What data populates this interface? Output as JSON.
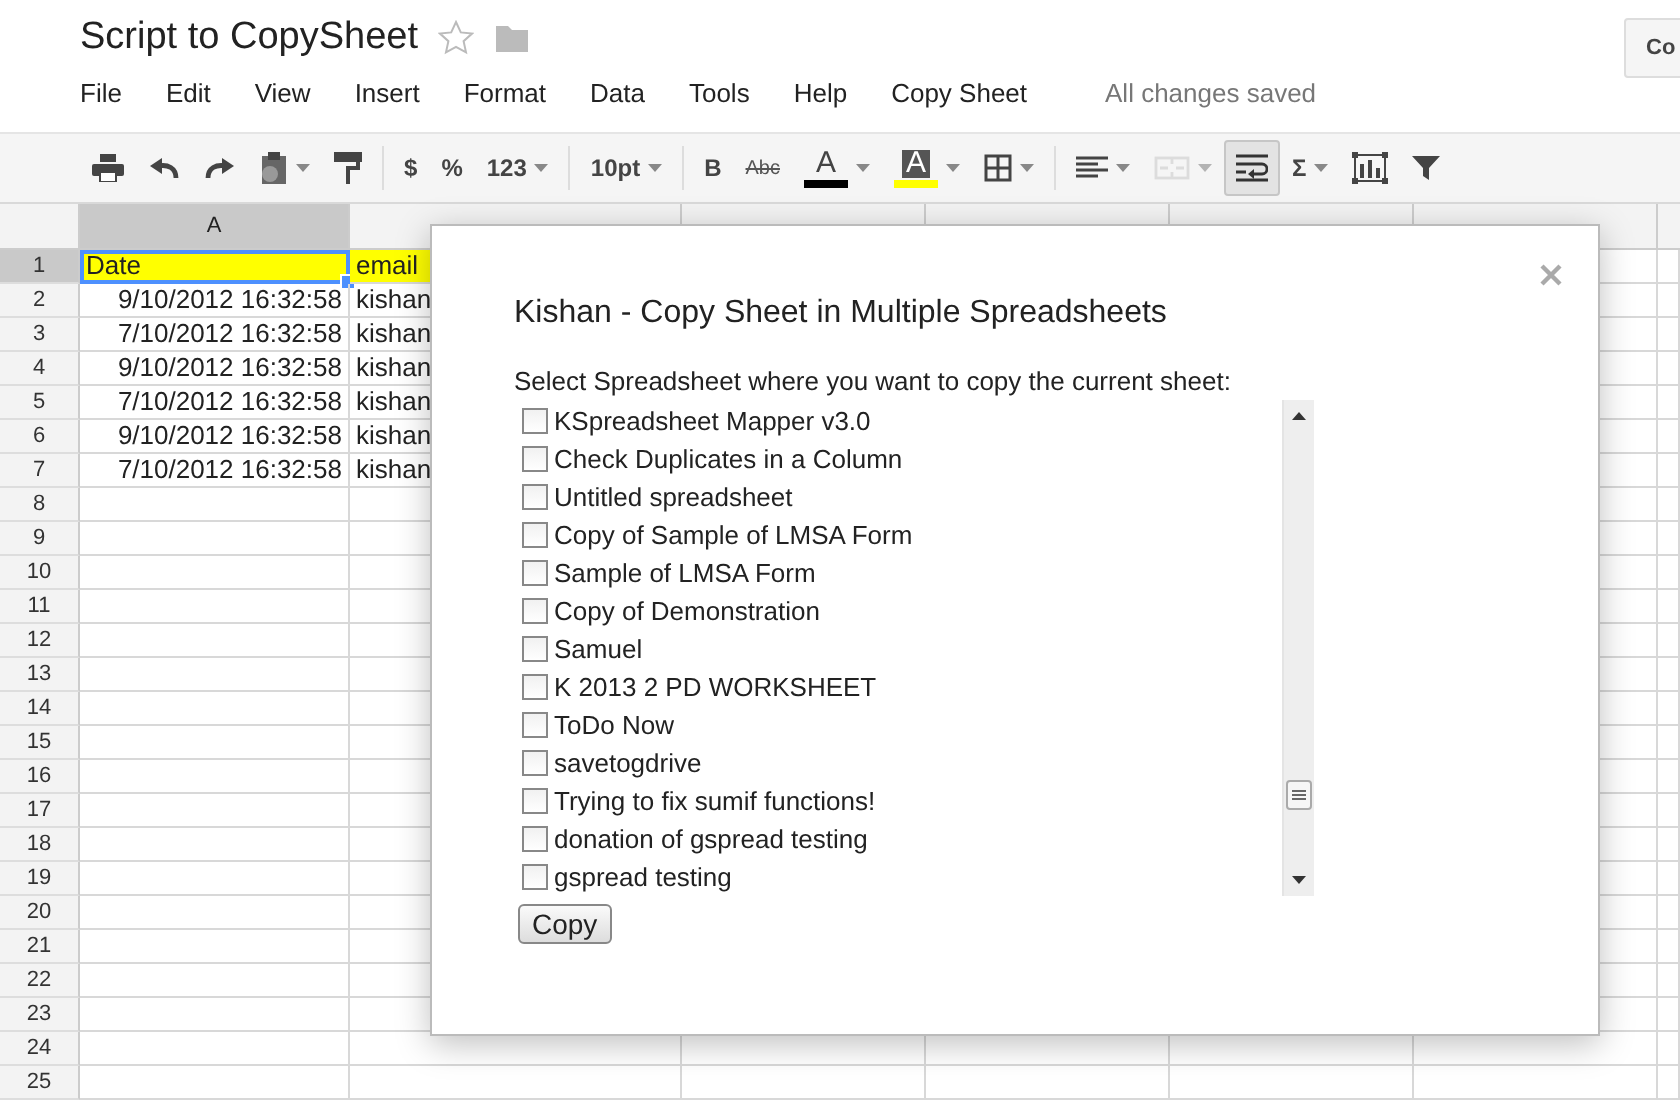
{
  "document": {
    "title": "Script to CopySheet",
    "starred": false
  },
  "menu": [
    "File",
    "Edit",
    "View",
    "Insert",
    "Format",
    "Data",
    "Tools",
    "Help",
    "Copy Sheet"
  ],
  "save_status": "All changes saved",
  "corner_button": "Co",
  "toolbar": [
    {
      "kind": "print",
      "dropdown": false,
      "pressed": false,
      "disabled": false
    },
    {
      "kind": "undo",
      "dropdown": false,
      "pressed": false,
      "disabled": false
    },
    {
      "kind": "redo",
      "dropdown": false,
      "pressed": false,
      "disabled": false
    },
    {
      "kind": "paste",
      "dropdown": true,
      "pressed": false,
      "disabled": false
    },
    {
      "kind": "paint-format",
      "dropdown": false,
      "pressed": false,
      "disabled": false
    },
    {
      "kind": "separator"
    },
    {
      "kind": "text",
      "label": "$",
      "dropdown": false,
      "pressed": false,
      "disabled": false
    },
    {
      "kind": "text",
      "label": "%",
      "dropdown": false,
      "pressed": false,
      "disabled": false
    },
    {
      "kind": "text",
      "label": "123",
      "dropdown": true,
      "pressed": false,
      "disabled": false
    },
    {
      "kind": "separator"
    },
    {
      "kind": "text",
      "label": "10pt",
      "dropdown": true,
      "pressed": false,
      "disabled": false
    },
    {
      "kind": "separator"
    },
    {
      "kind": "text",
      "label": "B",
      "dropdown": false,
      "pressed": false,
      "disabled": false
    },
    {
      "kind": "strike",
      "label": "Abc",
      "dropdown": false,
      "pressed": false,
      "disabled": false
    },
    {
      "kind": "text-color",
      "label": "A",
      "color": "#000000",
      "dropdown": true,
      "pressed": false,
      "disabled": false
    },
    {
      "kind": "fill-color",
      "label": "A",
      "color": "#ffff00",
      "dropdown": true,
      "pressed": false,
      "disabled": false
    },
    {
      "kind": "borders",
      "dropdown": true,
      "pressed": false,
      "disabled": false
    },
    {
      "kind": "separator"
    },
    {
      "kind": "align",
      "dropdown": true,
      "pressed": false,
      "disabled": false
    },
    {
      "kind": "merge",
      "dropdown": true,
      "pressed": false,
      "disabled": true
    },
    {
      "kind": "wrap",
      "dropdown": false,
      "pressed": true,
      "disabled": false
    },
    {
      "kind": "text",
      "label": "Σ",
      "dropdown": true,
      "pressed": false,
      "disabled": false
    },
    {
      "kind": "chart",
      "dropdown": false,
      "pressed": false,
      "disabled": false
    },
    {
      "kind": "filter",
      "dropdown": false,
      "pressed": false,
      "disabled": false
    }
  ],
  "sheet": {
    "columns": [
      {
        "label": "A",
        "selected": true
      },
      {
        "selected": false
      },
      {
        "selected": false
      },
      {
        "selected": false
      },
      {
        "selected": false
      },
      {
        "selected": false
      }
    ],
    "rows": [
      {
        "label": "1",
        "selected": true,
        "cells": [
          {
            "text": "Date",
            "kind": "text",
            "color": "#ffff00",
            "active": true
          },
          {
            "text": "email",
            "kind": "text",
            "color": "#ffff00",
            "active": false
          }
        ]
      },
      {
        "label": "2",
        "selected": false,
        "cells": [
          {
            "text": "9/10/2012 16:32:58",
            "kind": "date",
            "active": false
          },
          {
            "text": "kishan",
            "kind": "text",
            "active": false
          }
        ]
      },
      {
        "label": "3",
        "selected": false,
        "cells": [
          {
            "text": "7/10/2012 16:32:58",
            "kind": "date",
            "active": false
          },
          {
            "text": "kishan",
            "kind": "text",
            "active": false
          }
        ]
      },
      {
        "label": "4",
        "selected": false,
        "cells": [
          {
            "text": "9/10/2012 16:32:58",
            "kind": "date",
            "active": false
          },
          {
            "text": "kishan",
            "kind": "text",
            "active": false
          }
        ]
      },
      {
        "label": "5",
        "selected": false,
        "cells": [
          {
            "text": "7/10/2012 16:32:58",
            "kind": "date",
            "active": false
          },
          {
            "text": "kishan",
            "kind": "text",
            "active": false
          }
        ]
      },
      {
        "label": "6",
        "selected": false,
        "cells": [
          {
            "text": "9/10/2012 16:32:58",
            "kind": "date",
            "active": false
          },
          {
            "text": "kishan",
            "kind": "text",
            "active": false
          }
        ]
      },
      {
        "label": "7",
        "selected": false,
        "cells": [
          {
            "text": "7/10/2012 16:32:58",
            "kind": "date",
            "active": false
          },
          {
            "text": "kishan",
            "kind": "text",
            "active": false
          }
        ]
      },
      {
        "label": "8",
        "selected": false
      },
      {
        "label": "9",
        "selected": false
      },
      {
        "label": "10",
        "selected": false
      },
      {
        "label": "11",
        "selected": false
      },
      {
        "label": "12",
        "selected": false
      },
      {
        "label": "13",
        "selected": false
      },
      {
        "label": "14",
        "selected": false
      },
      {
        "label": "15",
        "selected": false
      },
      {
        "label": "16",
        "selected": false
      },
      {
        "label": "17",
        "selected": false
      },
      {
        "label": "18",
        "selected": false
      },
      {
        "label": "19",
        "selected": false
      },
      {
        "label": "20",
        "selected": false
      },
      {
        "label": "21",
        "selected": false
      },
      {
        "label": "22",
        "selected": false
      },
      {
        "label": "23",
        "selected": false
      },
      {
        "label": "24",
        "selected": false
      },
      {
        "label": "25",
        "selected": false
      }
    ]
  },
  "dialog": {
    "title": "Kishan - Copy Sheet in Multiple Spreadsheets",
    "prompt": "Select Spreadsheet where you want to copy the current sheet:",
    "options": [
      {
        "label": "KSpreadsheet Mapper v3.0",
        "checked": false
      },
      {
        "label": "Check Duplicates in a Column",
        "checked": false
      },
      {
        "label": "Untitled spreadsheet",
        "checked": false
      },
      {
        "label": "Copy of Sample of LMSA Form",
        "checked": false
      },
      {
        "label": "Sample of LMSA Form",
        "checked": false
      },
      {
        "label": "Copy of Demonstration",
        "checked": false
      },
      {
        "label": "Samuel",
        "checked": false
      },
      {
        "label": "K 2013 2 PD WORKSHEET",
        "checked": false
      },
      {
        "label": "ToDo Now",
        "checked": false
      },
      {
        "label": "savetogdrive",
        "checked": false
      },
      {
        "label": "Trying to fix sumif functions!",
        "checked": false
      },
      {
        "label": "donation of gspread testing",
        "checked": false
      },
      {
        "label": "gspread testing",
        "checked": false
      }
    ],
    "button": "Copy"
  }
}
